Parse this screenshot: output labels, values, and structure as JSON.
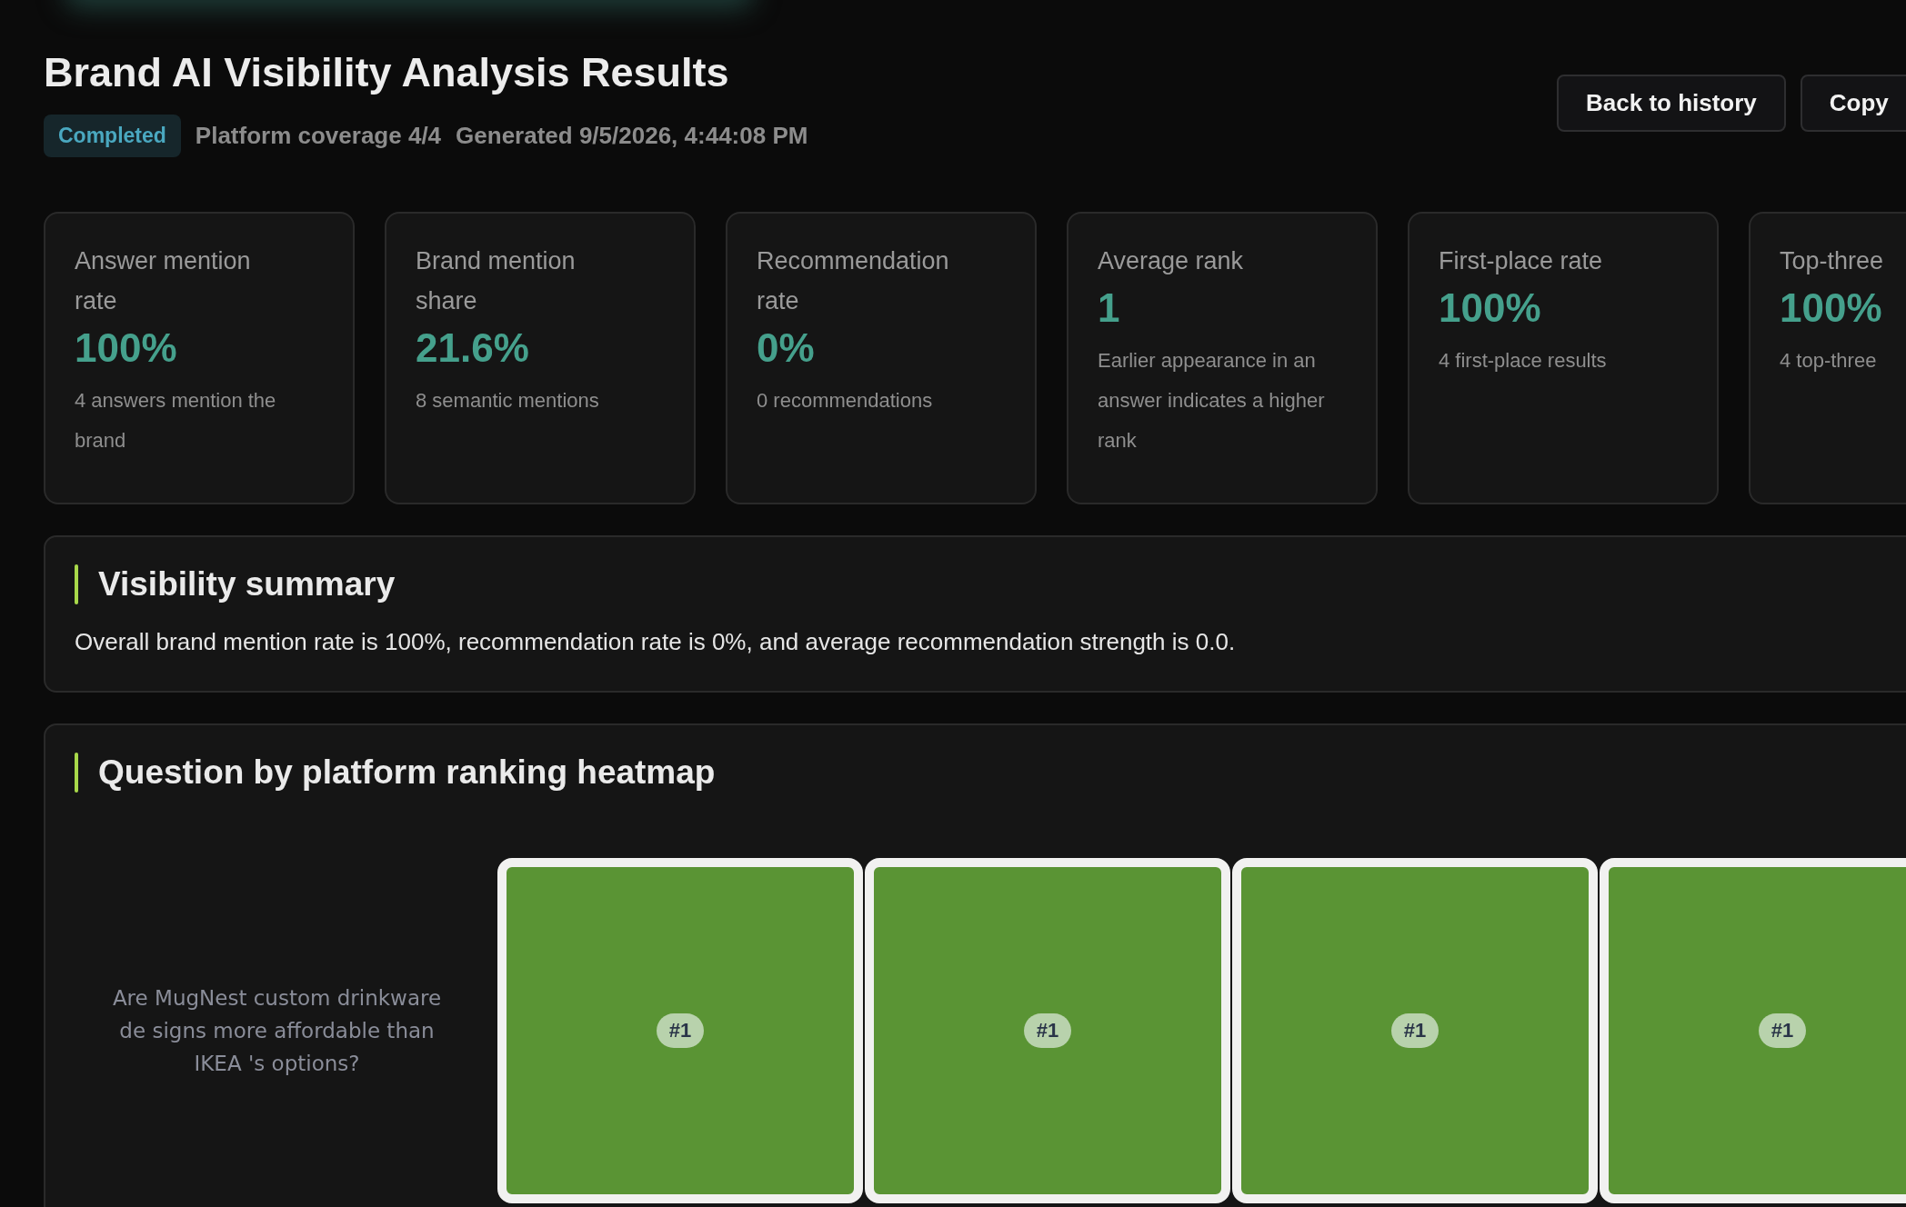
{
  "header": {
    "title": "Brand AI Visibility Analysis Results",
    "status": {
      "label": "Completed",
      "kind": "completed"
    },
    "meta": [
      "Platform coverage 4/4",
      "Generated 9/5/2026, 4:44:08 PM"
    ],
    "buttons": [
      "Back to history",
      "Copy"
    ]
  },
  "metrics": [
    {
      "label": "Answer mention rate",
      "value": "100%",
      "note": "4 answers mention the brand"
    },
    {
      "label": "Brand mention share",
      "value": "21.6%",
      "note": "8 semantic mentions"
    },
    {
      "label": "Recommendation rate",
      "value": "0%",
      "note": "0 recommendations"
    },
    {
      "label": "Average rank",
      "value": "1",
      "note": "Earlier appearance in an answer indicates a higher rank"
    },
    {
      "label": "First-place rate",
      "value": "100%",
      "note": "4 first-place results"
    },
    {
      "label": "Top-three",
      "value": "100%",
      "note": "4 top-three"
    }
  ],
  "summary": {
    "title": "Visibility summary",
    "text": "Overall brand mention rate is 100%, recommendation rate is 0%, and average recommendation strength is 0.0."
  },
  "heatmap": {
    "title": "Question by platform ranking heatmap",
    "rows": [
      {
        "question": "Are MugNest custom drinkware de signs more affordable than IKEA 's options?",
        "cells": [
          {
            "rank": "#1",
            "color": "#5a9434"
          },
          {
            "rank": "#1",
            "color": "#5a9434"
          },
          {
            "rank": "#1",
            "color": "#5a9434"
          },
          {
            "rank": "#1",
            "color": "#5a9434"
          }
        ]
      }
    ]
  }
}
